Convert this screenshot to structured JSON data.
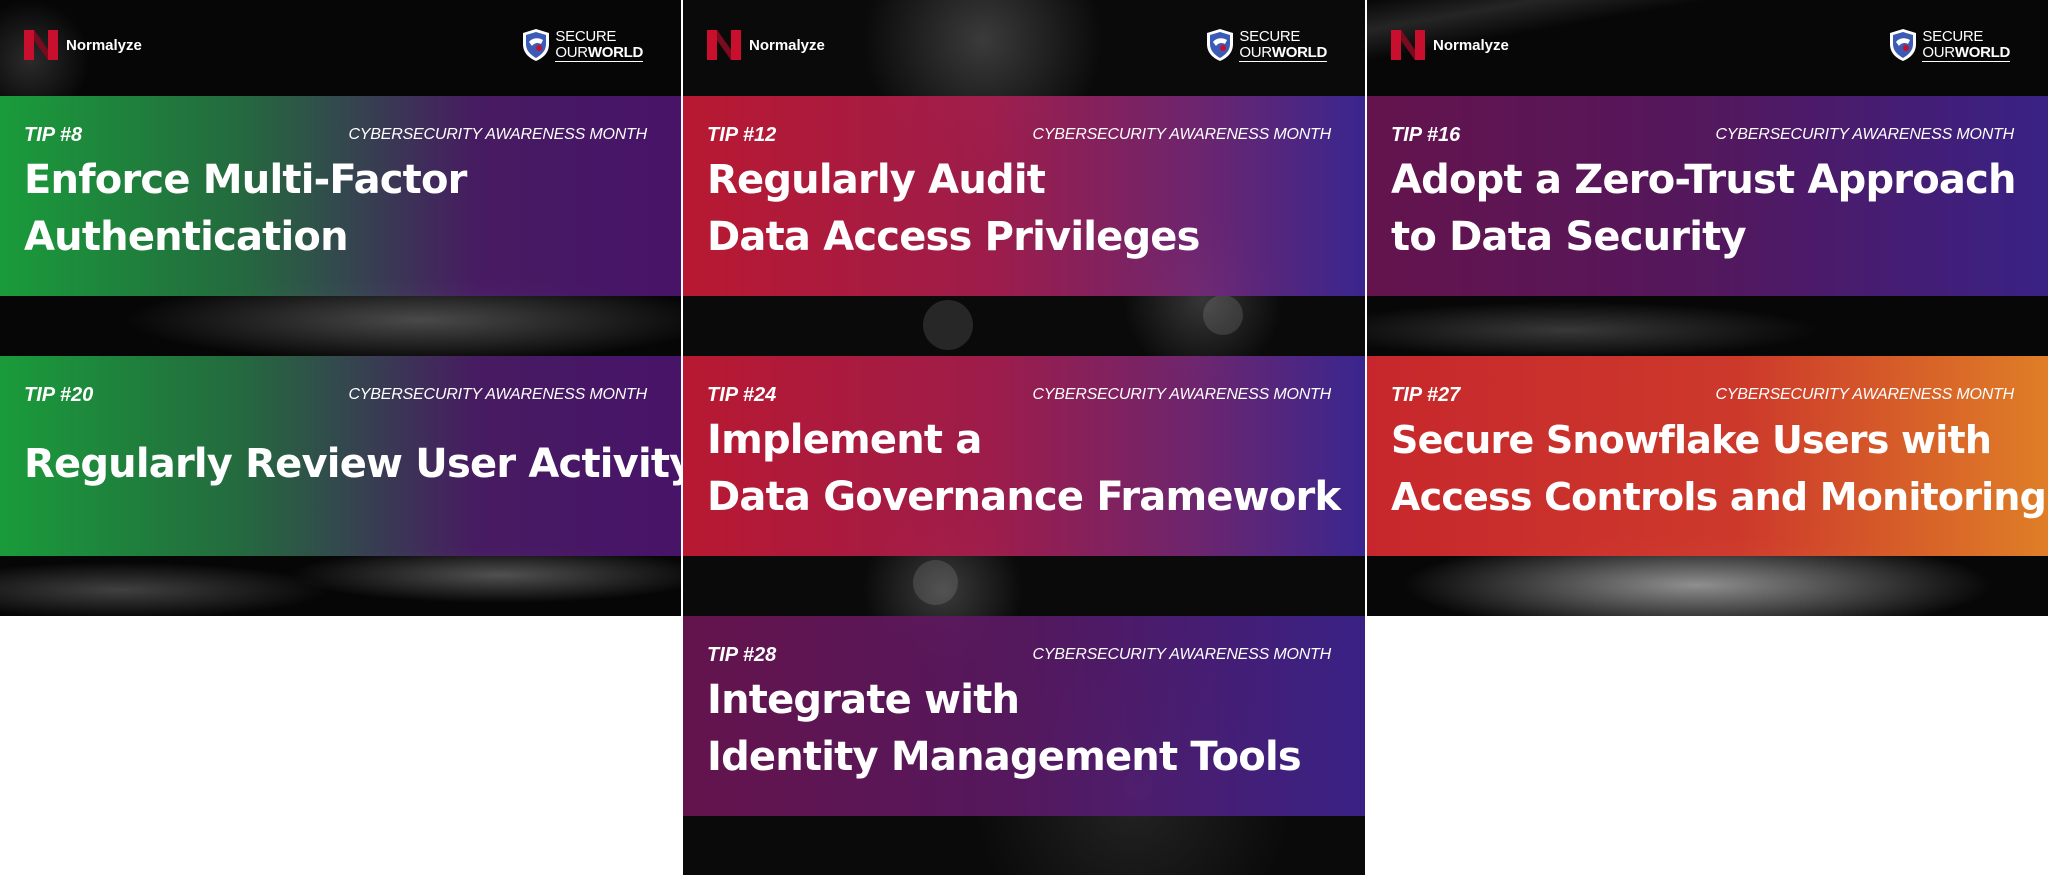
{
  "brand": {
    "name": "Normalyze"
  },
  "partner": {
    "line1": "SECURE",
    "line2_a": "OUR",
    "line2_b": "WORLD"
  },
  "month_label": "CYBERSECURITY AWARENESS MONTH",
  "tiles": [
    {
      "tip": "TIP #8",
      "title_lines": [
        "Enforce Multi-Factor",
        "Authentication"
      ]
    },
    {
      "tip": "TIP #20",
      "title_lines": [
        "Regularly Review User Activity"
      ]
    },
    {
      "tip": "TIP #12",
      "title_lines": [
        "Regularly Audit",
        "Data Access Privileges"
      ]
    },
    {
      "tip": "TIP #24",
      "title_lines": [
        "Implement a",
        "Data Governance Framework"
      ]
    },
    {
      "tip": "TIP #28",
      "title_lines": [
        "Integrate with",
        "Identity Management Tools"
      ]
    },
    {
      "tip": "TIP #16",
      "title_lines": [
        "Adopt a Zero-Trust Approach",
        "to Data Security"
      ]
    },
    {
      "tip": "TIP #27",
      "title_lines": [
        "Secure Snowflake Users with",
        "Access Controls and Monitoring"
      ]
    }
  ],
  "colors": {
    "green": "#1aa03c",
    "red": "#be1932",
    "purple": "#69144f",
    "indigo": "#3c288c",
    "orange": "#e68228"
  },
  "icons": [
    "normalyze-logo-icon",
    "secure-our-world-shield-icon"
  ]
}
